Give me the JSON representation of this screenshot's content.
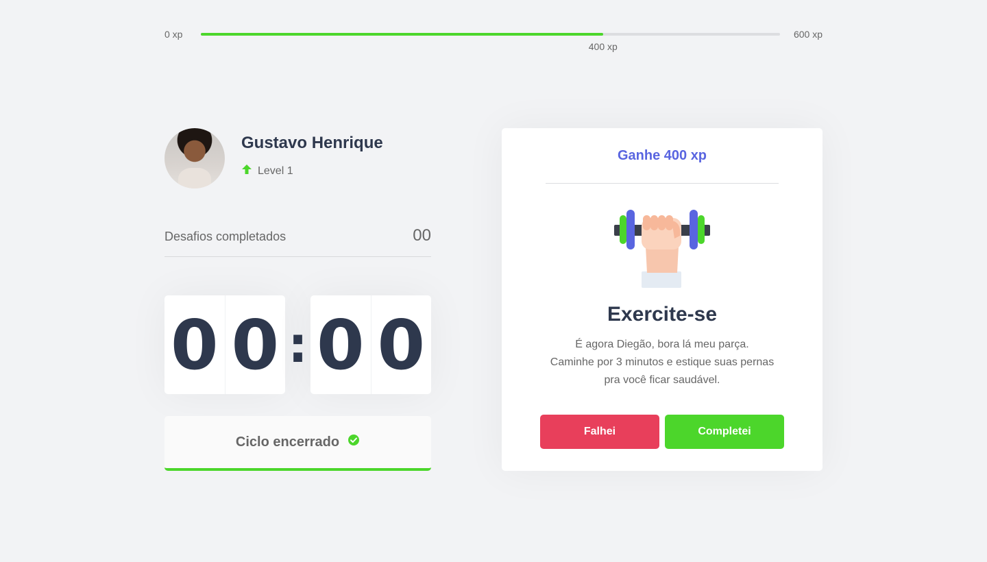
{
  "xp_bar": {
    "min_label": "0 xp",
    "max_label": "600 xp",
    "current_label": "400 xp",
    "progress_fraction": 0.6944,
    "fill_color": "#4cd62b",
    "track_color": "#dcdde0"
  },
  "profile": {
    "name": "Gustavo Henrique",
    "level_label": "Level 1",
    "level_icon": "arrow-up-icon"
  },
  "challenges": {
    "label": "Desafios completados",
    "count": "00"
  },
  "countdown": {
    "minute_left": "0",
    "minute_right": "0",
    "separator": ":",
    "second_left": "0",
    "second_right": "0"
  },
  "cycle_button": {
    "label": "Ciclo encerrado",
    "icon": "check-circle-icon",
    "accent_color": "#4cd62b"
  },
  "challenge_card": {
    "header": "Ganhe 400 xp",
    "illustration": "dumbbell-hand-icon",
    "title": "Exercite-se",
    "description_lines": [
      "É agora Diegão, bora lá meu parça.",
      "Caminhe por 3 minutos e estique suas pernas",
      "pra você ficar saudável."
    ],
    "fail_button": "Falhei",
    "done_button": "Completei",
    "fail_color": "#e83f5b",
    "done_color": "#4cd62b",
    "header_color": "#5965e0"
  }
}
